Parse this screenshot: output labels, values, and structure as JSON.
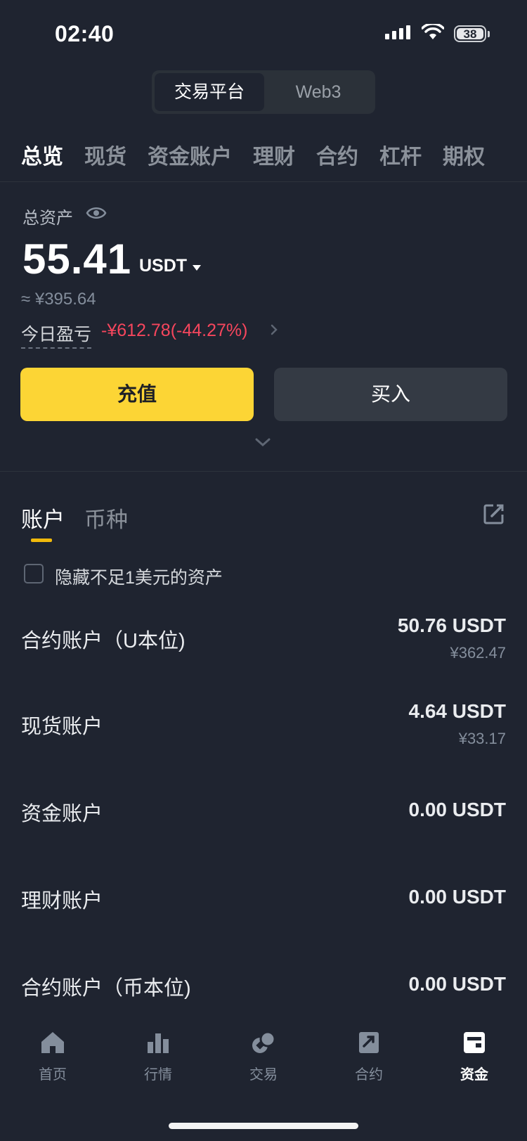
{
  "status": {
    "time": "02:40",
    "battery": "38"
  },
  "segment": {
    "exchange": "交易平台",
    "web3": "Web3"
  },
  "categories": [
    "总览",
    "现货",
    "资金账户",
    "理财",
    "合约",
    "杠杆",
    "期权"
  ],
  "summary": {
    "total_label": "总资产",
    "amount": "55.41",
    "unit": "USDT",
    "approx": "≈ ¥395.64",
    "pnl_label": "今日盈亏",
    "pnl_value": "-¥612.78(-44.27%)"
  },
  "actions": {
    "deposit": "充值",
    "buy": "买入"
  },
  "account_tabs": {
    "accounts": "账户",
    "coins": "币种"
  },
  "hide_small": "隐藏不足1美元的资产",
  "accounts": [
    {
      "name": "合约账户（U本位)",
      "value": "50.76 USDT",
      "cny": "¥362.47"
    },
    {
      "name": "现货账户",
      "value": "4.64 USDT",
      "cny": "¥33.17"
    },
    {
      "name": "资金账户",
      "value": "0.00 USDT",
      "cny": ""
    },
    {
      "name": "理财账户",
      "value": "0.00 USDT",
      "cny": ""
    },
    {
      "name": "合约账户（币本位)",
      "value": "0.00 USDT",
      "cny": ""
    }
  ],
  "nav": [
    {
      "label": "首页",
      "icon": "home-icon"
    },
    {
      "label": "行情",
      "icon": "market-icon"
    },
    {
      "label": "交易",
      "icon": "trade-icon"
    },
    {
      "label": "合约",
      "icon": "futures-icon"
    },
    {
      "label": "资金",
      "icon": "wallet-icon"
    }
  ],
  "colors": {
    "accent": "#fcd535",
    "loss": "#f6465d",
    "background": "#1f2430"
  }
}
